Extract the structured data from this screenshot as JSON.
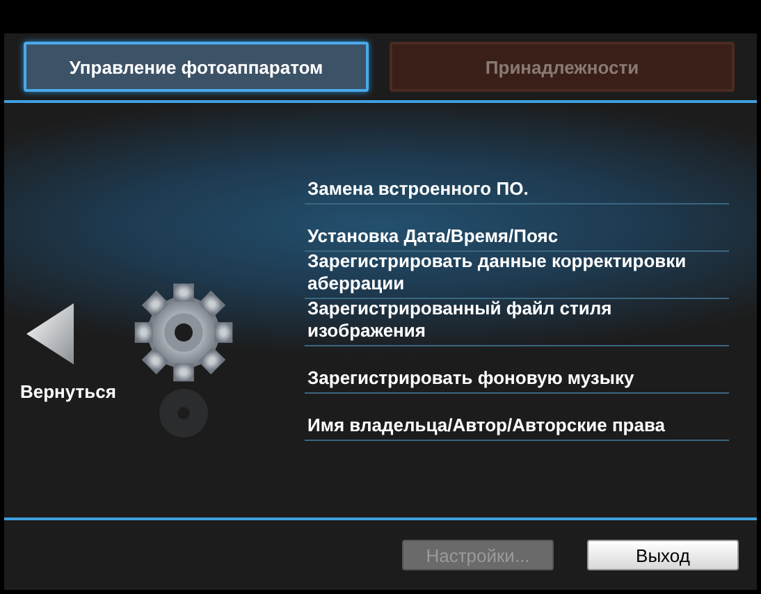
{
  "tabs": [
    {
      "label": "Управление фотоаппаратом",
      "selected": true
    },
    {
      "label": "Принадлежности",
      "selected": false
    }
  ],
  "back": {
    "label": "Вернуться"
  },
  "menu_items": [
    {
      "label": "Замена встроенного ПО."
    },
    {
      "label": "Установка Дата/Время/Пояс"
    },
    {
      "label": "Зарегистрировать данные корректировки аберрации"
    },
    {
      "label": "Зарегистрированный файл стиля изображения"
    },
    {
      "label": "Зарегистрировать фоновую музыку"
    },
    {
      "label": "Имя владельца/Автор/Авторские права"
    }
  ],
  "buttons": [
    {
      "label": "Настройки...",
      "disabled": true
    },
    {
      "label": "Выход",
      "disabled": false
    }
  ]
}
